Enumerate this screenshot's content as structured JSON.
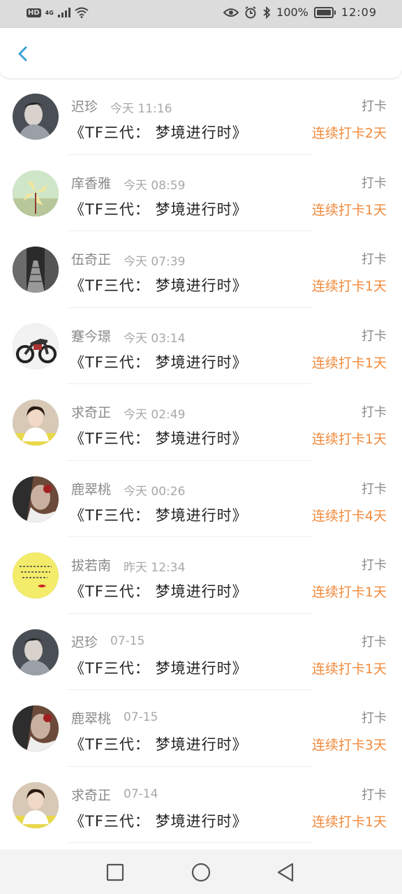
{
  "status_bar": {
    "hd": "HD",
    "network": "4G",
    "battery": "100%",
    "time": "12:09"
  },
  "header": {
    "back_icon": "chevron-left-icon",
    "accent_color": "#3aa1d8"
  },
  "colors": {
    "streak": "#f08a3c",
    "name": "#8a8a8a"
  },
  "records": [
    {
      "name": "迟珍",
      "time": "今天 11:16",
      "title": "《TF三代： 梦境进行时》",
      "tag": "打卡",
      "streak": "连续打卡2天",
      "avatar": "portrait-icon"
    },
    {
      "name": "庠香雅",
      "time": "今天 08:59",
      "title": "《TF三代： 梦境进行时》",
      "tag": "打卡",
      "streak": "连续打卡1天",
      "avatar": "pinwheel-icon"
    },
    {
      "name": "伍奇正",
      "time": "今天 07:39",
      "title": "《TF三代： 梦境进行时》",
      "tag": "打卡",
      "streak": "连续打卡1天",
      "avatar": "street-photo-icon"
    },
    {
      "name": "蹇今璟",
      "time": "今天 03:14",
      "title": "《TF三代： 梦境进行时》",
      "tag": "打卡",
      "streak": "连续打卡1天",
      "avatar": "motorcycle-icon"
    },
    {
      "name": "求奇正",
      "time": "今天 02:49",
      "title": "《TF三代： 梦境进行时》",
      "tag": "打卡",
      "streak": "连续打卡1天",
      "avatar": "woman-portrait-icon"
    },
    {
      "name": "鹿翠桃",
      "time": "今天 00:26",
      "title": "《TF三代： 梦境进行时》",
      "tag": "打卡",
      "streak": "连续打卡4天",
      "avatar": "artwork-icon"
    },
    {
      "name": "拔若南",
      "time": "昨天 12:34",
      "title": "《TF三代： 梦境进行时》",
      "tag": "打卡",
      "streak": "连续打卡1天",
      "avatar": "yellow-note-icon"
    },
    {
      "name": "迟珍",
      "time": "07-15",
      "title": "《TF三代： 梦境进行时》",
      "tag": "打卡",
      "streak": "连续打卡1天",
      "avatar": "portrait-icon"
    },
    {
      "name": "鹿翠桃",
      "time": "07-15",
      "title": "《TF三代： 梦境进行时》",
      "tag": "打卡",
      "streak": "连续打卡3天",
      "avatar": "artwork-icon"
    },
    {
      "name": "求奇正",
      "time": "07-14",
      "title": "《TF三代： 梦境进行时》",
      "tag": "打卡",
      "streak": "连续打卡1天",
      "avatar": "woman-portrait-icon"
    }
  ],
  "nav_bar": {
    "recent": "square-icon",
    "home": "circle-icon",
    "back": "triangle-back-icon"
  }
}
